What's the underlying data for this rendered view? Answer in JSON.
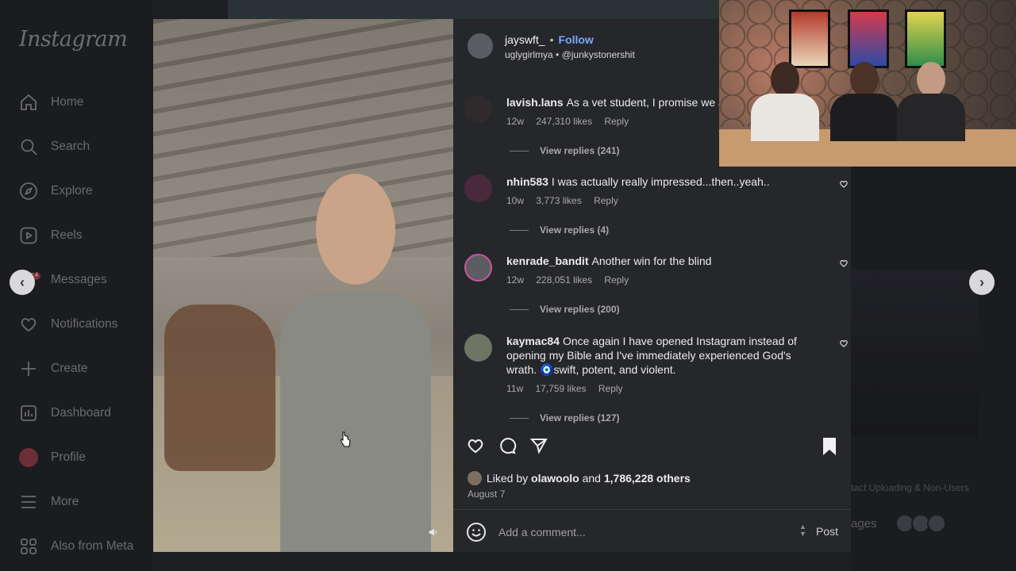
{
  "sidebar": {
    "logo": "Instagram",
    "items": [
      {
        "label": "Home",
        "icon": "home-icon"
      },
      {
        "label": "Search",
        "icon": "search-icon"
      },
      {
        "label": "Explore",
        "icon": "compass-icon"
      },
      {
        "label": "Reels",
        "icon": "reels-icon"
      },
      {
        "label": "Messages",
        "icon": "messages-icon",
        "badge": "4"
      },
      {
        "label": "Notifications",
        "icon": "heart-icon"
      },
      {
        "label": "Create",
        "icon": "plus-icon"
      },
      {
        "label": "Dashboard",
        "icon": "dashboard-icon"
      },
      {
        "label": "Profile",
        "icon": "profile-avatar"
      },
      {
        "label": "More",
        "icon": "menu-icon"
      },
      {
        "label": "Also from Meta",
        "icon": "grid-icon"
      }
    ]
  },
  "post": {
    "author": "jayswft_",
    "follow_label": "Follow",
    "audio_user": "uglygirlmya",
    "audio_tag": "@junkystonershit",
    "liked_by_prefix": "Liked by",
    "liked_by_user": "olawoolo",
    "liked_by_and": "and",
    "liked_by_count": "1,786,228 others",
    "date": "August 7",
    "comment_placeholder": "Add a comment...",
    "post_label": "Post"
  },
  "comments": [
    {
      "user": "lavish.lans",
      "text": "As a vet student, I promise we ar",
      "age": "12w",
      "likes": "247,310 likes",
      "reply": "Reply",
      "replies": "View replies (241)"
    },
    {
      "user": "nhin583",
      "text": "I was actually really impressed...then..yeah..",
      "age": "10w",
      "likes": "3,773 likes",
      "reply": "Reply",
      "replies": "View replies (4)"
    },
    {
      "user": "kenrade_bandit",
      "text": "Another win for the blind",
      "age": "12w",
      "likes": "228,051 likes",
      "reply": "Reply",
      "replies": "View replies (200)"
    },
    {
      "user": "kaymac84",
      "text": "Once again I have opened Instagram instead of opening my Bible and I've immediately experienced God's wrath. 🧿swift, potent, and violent.",
      "age": "11w",
      "likes": "17,759 likes",
      "reply": "Reply",
      "replies": "View replies (127)"
    }
  ],
  "background": {
    "ghost_text": "tact Uploading & Non-Users",
    "ghost_pages": "ages"
  },
  "colors": {
    "follow": "#7aa7ff",
    "panel": "#26272b",
    "sidebar": "#1b1c20"
  }
}
